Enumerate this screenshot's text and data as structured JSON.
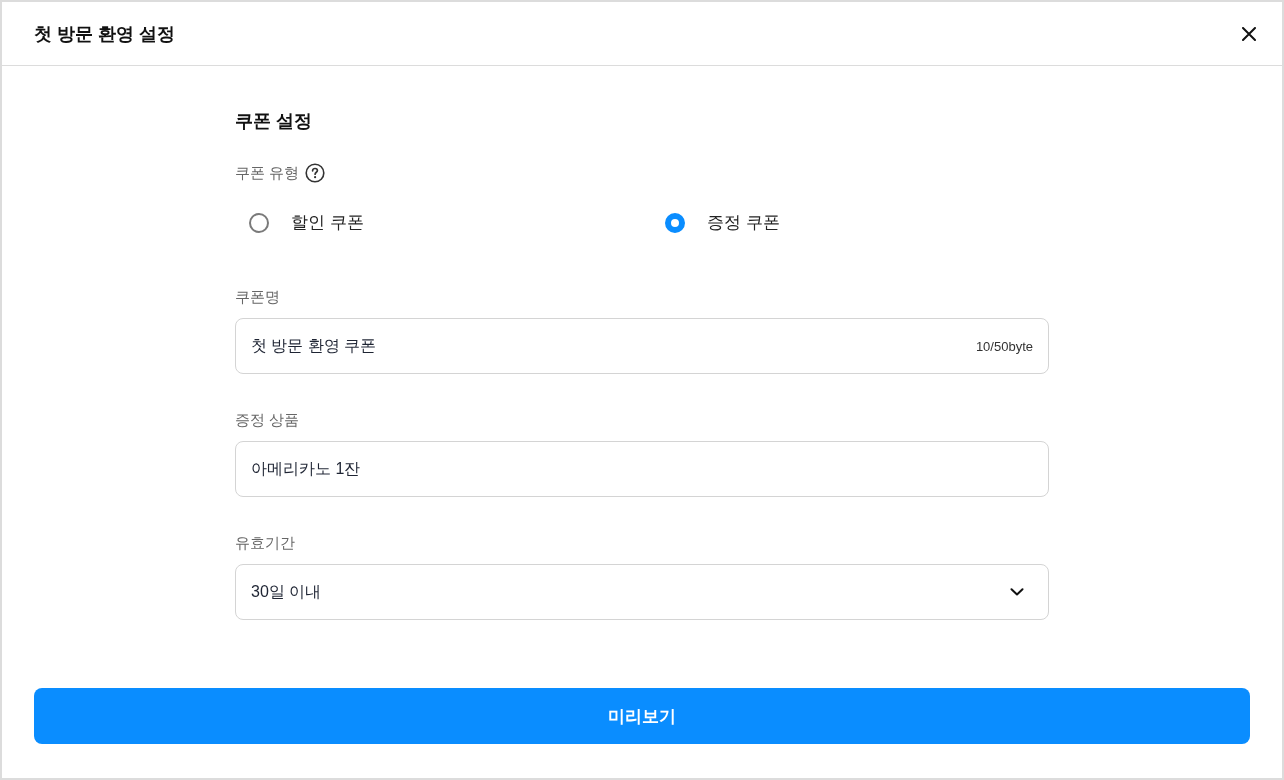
{
  "dialog": {
    "title": "첫 방문 환영 설정"
  },
  "section": {
    "title": "쿠폰 설정"
  },
  "coupon_type": {
    "label": "쿠폰 유형",
    "options": [
      {
        "label": "할인 쿠폰",
        "selected": false
      },
      {
        "label": "증정 쿠폰",
        "selected": true
      }
    ]
  },
  "fields": [
    {
      "kind": "text",
      "label": "쿠폰명",
      "value": "첫 방문 환영 쿠폰",
      "counter": "10/50byte"
    },
    {
      "kind": "text",
      "label": "증정 상품",
      "value": "아메리카노 1잔"
    },
    {
      "kind": "select",
      "label": "유효기간",
      "value": "30일 이내"
    }
  ],
  "primary_button": {
    "label": "미리보기"
  }
}
